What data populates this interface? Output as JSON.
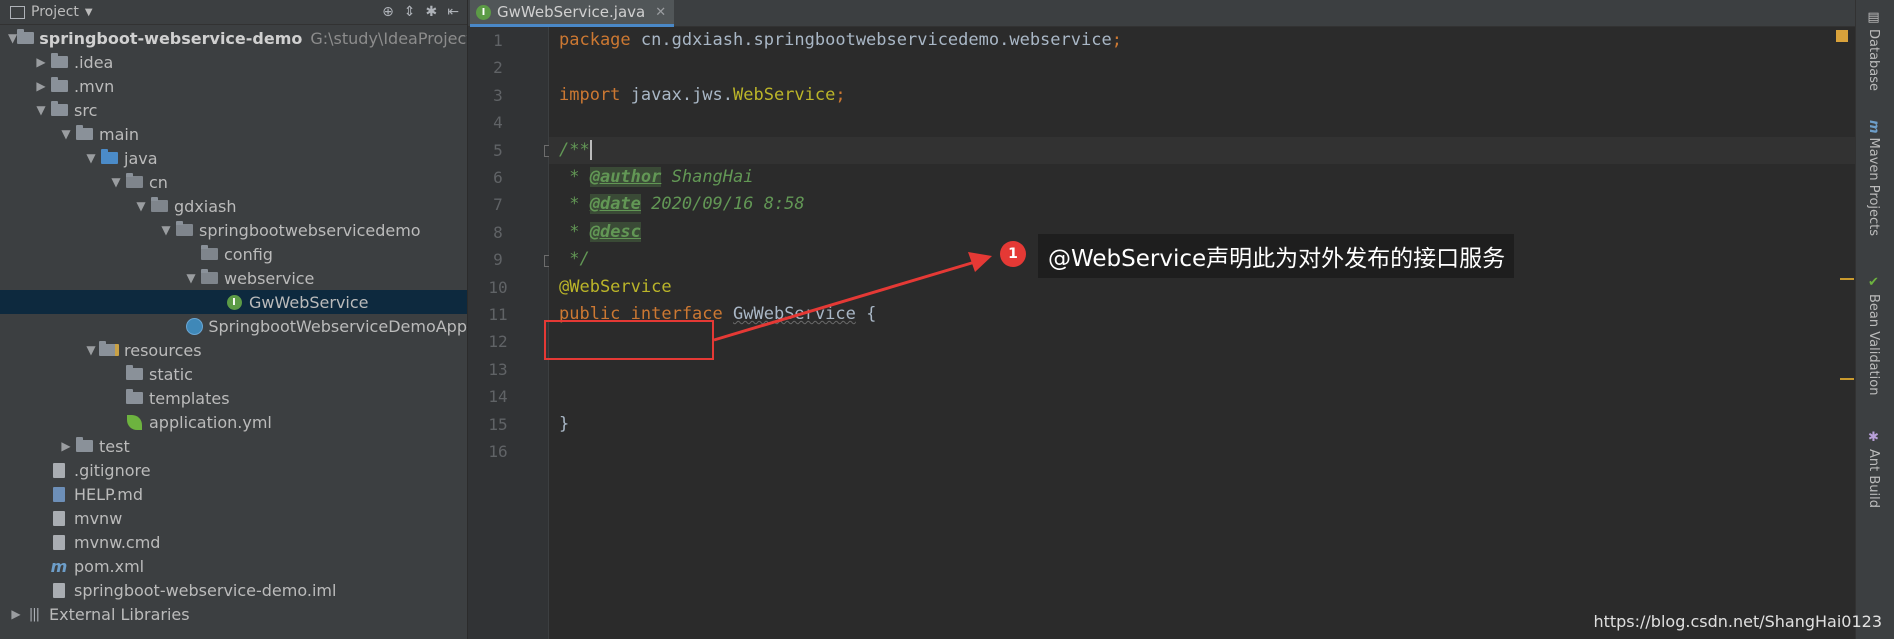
{
  "project_panel": {
    "title": "Project",
    "tree": [
      {
        "label": "springboot-webservice-demo",
        "path": "G:\\study\\IdeaProject\\spr",
        "icon": "folder-icon",
        "depth": 0,
        "expanded": true
      },
      {
        "label": ".idea",
        "icon": "folder-icon",
        "depth": 1,
        "expanded": false
      },
      {
        "label": ".mvn",
        "icon": "folder-icon",
        "depth": 1,
        "expanded": false
      },
      {
        "label": "src",
        "icon": "folder-icon",
        "depth": 1,
        "expanded": true
      },
      {
        "label": "main",
        "icon": "folder-icon",
        "depth": 2,
        "expanded": true
      },
      {
        "label": "java",
        "icon": "source-folder-icon",
        "depth": 3,
        "expanded": true
      },
      {
        "label": "cn",
        "icon": "package-icon",
        "depth": 4,
        "expanded": true
      },
      {
        "label": "gdxiash",
        "icon": "package-icon",
        "depth": 5,
        "expanded": true
      },
      {
        "label": "springbootwebservicedemo",
        "icon": "package-icon",
        "depth": 6,
        "expanded": true
      },
      {
        "label": "config",
        "icon": "package-icon",
        "depth": 7
      },
      {
        "label": "webservice",
        "icon": "package-icon",
        "depth": 7,
        "expanded": true
      },
      {
        "label": "GwWebService",
        "icon": "interface-icon",
        "depth": 8,
        "selected": true
      },
      {
        "label": "SpringbootWebserviceDemoApp",
        "icon": "spring-boot-class-icon",
        "depth": 7
      },
      {
        "label": "resources",
        "icon": "resources-folder-icon",
        "depth": 3,
        "expanded": true
      },
      {
        "label": "static",
        "icon": "folder-icon",
        "depth": 4
      },
      {
        "label": "templates",
        "icon": "folder-icon",
        "depth": 4
      },
      {
        "label": "application.yml",
        "icon": "spring-config-icon",
        "depth": 4
      },
      {
        "label": "test",
        "icon": "folder-icon",
        "depth": 2,
        "expanded": false
      },
      {
        "label": ".gitignore",
        "icon": "file-icon",
        "depth": 1
      },
      {
        "label": "HELP.md",
        "icon": "markdown-file-icon",
        "depth": 1
      },
      {
        "label": "mvnw",
        "icon": "file-icon",
        "depth": 1
      },
      {
        "label": "mvnw.cmd",
        "icon": "file-icon",
        "depth": 1
      },
      {
        "label": "pom.xml",
        "icon": "maven-icon",
        "depth": 1
      },
      {
        "label": "springboot-webservice-demo.iml",
        "icon": "file-icon",
        "depth": 1
      },
      {
        "label": "External Libraries",
        "icon": "libraries-icon",
        "depth": 0,
        "expanded": false
      }
    ]
  },
  "editor": {
    "tab_label": "GwWebService.java",
    "lines": [
      {
        "n": "1",
        "html": "<span class=\"kw\">package</span> cn.gdxiash.springbootwebservicedemo.webservice<span class=\"kw\">;</span>"
      },
      {
        "n": "2",
        "html": ""
      },
      {
        "n": "3",
        "html": "<span class=\"kw\">import</span> javax.jws.<span class=\"ann\">WebService</span><span class=\"kw\">;</span>"
      },
      {
        "n": "4",
        "html": ""
      },
      {
        "n": "5",
        "html": "<span class=\"cmt\">/**</span>"
      },
      {
        "n": "6",
        "html": "<span class=\"cmt\"> * </span><span class=\"tag\">@author</span><span class=\"cmt\"> ShangHai</span>"
      },
      {
        "n": "7",
        "html": "<span class=\"cmt\"> * </span><span class=\"tag\">@date</span><span class=\"cmt\"> 2020/09/16 8:58</span>"
      },
      {
        "n": "8",
        "html": "<span class=\"cmt\"> * </span><span class=\"tag\">@desc</span>"
      },
      {
        "n": "9",
        "html": "<span class=\"cmt\"> */</span>"
      },
      {
        "n": "10",
        "html": "<span class=\"ann\">@WebService</span>"
      },
      {
        "n": "11",
        "html": "<span class=\"kw\">public interface</span> <span class=\"iface-name\">GwWebService</span> {"
      },
      {
        "n": "12",
        "html": ""
      },
      {
        "n": "13",
        "html": ""
      },
      {
        "n": "14",
        "html": ""
      },
      {
        "n": "15",
        "html": "}"
      },
      {
        "n": "16",
        "html": ""
      }
    ]
  },
  "annotation": {
    "badge": "1",
    "label": "@WebService声明此为对外发布的接口服务"
  },
  "right_strip": {
    "tabs": [
      "Database",
      "Maven Projects",
      "Bean Validation",
      "Ant Build"
    ]
  },
  "watermark": "https://blog.csdn.net/ShangHai0123",
  "colors": {
    "keyword": "#cc7832",
    "annotation": "#bbb529",
    "comment": "#629755",
    "selection": "#0d293e",
    "highlight_red": "#e53935"
  }
}
